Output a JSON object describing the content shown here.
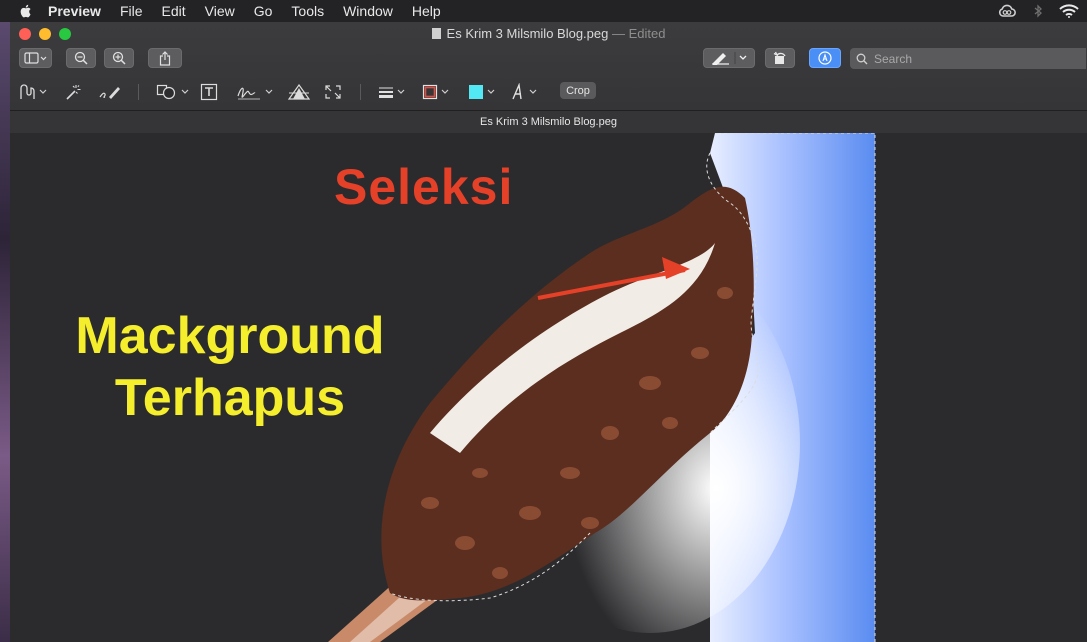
{
  "menubar": {
    "app_name": "Preview",
    "items": [
      "File",
      "Edit",
      "View",
      "Go",
      "Tools",
      "Window",
      "Help"
    ],
    "status_icons": [
      "creative-cloud-icon",
      "bluetooth-icon",
      "wifi-icon"
    ]
  },
  "window": {
    "title": "Es Krim 3 Milsmilo Blog.peg",
    "title_suffix": "— Edited",
    "tab_title": "Es Krim 3 Milsmilo Blog.peg"
  },
  "toolbar": {
    "search_placeholder": "Search",
    "crop_label": "Crop"
  },
  "image_overlay": {
    "annotation_label": "Seleksi",
    "annotation_color": "#e54028",
    "caption_line1": "Mackground",
    "caption_line2": "Terhapus",
    "caption_color": "#f5ee2d"
  },
  "colors": {
    "menubar": "#232225",
    "window_chrome": "#3a3a3c",
    "canvas": "#2b2b2d",
    "accent": "#4a8ff5"
  }
}
